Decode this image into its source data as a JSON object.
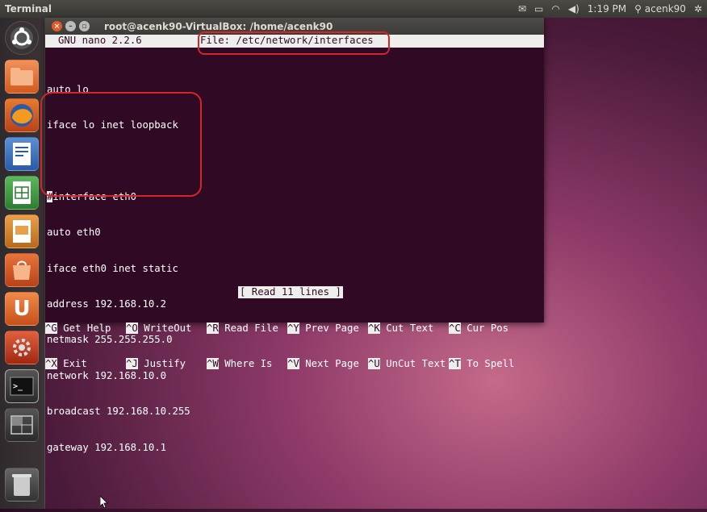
{
  "top_panel": {
    "app_name": "Terminal",
    "time": "1:19 PM",
    "user": "acenk90"
  },
  "window": {
    "title": "root@acenk90-VirtualBox: /home/acenk90"
  },
  "nano": {
    "version": "GNU nano 2.2.6",
    "file": "File: /etc/network/interfaces",
    "lines": [
      "",
      "auto lo",
      "iface lo inet loopback",
      "",
      "interface eth0",
      "auto eth0",
      "iface eth0 inet static",
      "address 192.168.10.2",
      "netmask 255.255.255.0",
      "network 192.168.10.0",
      "broadcast 192.168.10.255",
      "gateway 192.168.10.1"
    ],
    "cursor_char": "#",
    "status": "[ Read 11 lines ]",
    "shortcuts_row1": [
      {
        "key": "^G",
        "label": "Get Help"
      },
      {
        "key": "^O",
        "label": "WriteOut"
      },
      {
        "key": "^R",
        "label": "Read File"
      },
      {
        "key": "^Y",
        "label": "Prev Page"
      },
      {
        "key": "^K",
        "label": "Cut Text"
      },
      {
        "key": "^C",
        "label": "Cur Pos"
      }
    ],
    "shortcuts_row2": [
      {
        "key": "^X",
        "label": "Exit"
      },
      {
        "key": "^J",
        "label": "Justify"
      },
      {
        "key": "^W",
        "label": "Where Is"
      },
      {
        "key": "^V",
        "label": "Next Page"
      },
      {
        "key": "^U",
        "label": "UnCut Text"
      },
      {
        "key": "^T",
        "label": "To Spell"
      }
    ]
  },
  "launcher": [
    {
      "name": "dash-home-icon"
    },
    {
      "name": "files-icon"
    },
    {
      "name": "firefox-icon"
    },
    {
      "name": "writer-icon"
    },
    {
      "name": "calc-icon"
    },
    {
      "name": "impress-icon"
    },
    {
      "name": "software-center-icon"
    },
    {
      "name": "ubuntu-one-icon"
    },
    {
      "name": "system-settings-icon"
    },
    {
      "name": "terminal-icon"
    },
    {
      "name": "workspace-switcher-icon"
    },
    {
      "name": "trash-icon"
    }
  ],
  "colors": {
    "terminal_bg": "#300a24",
    "annotation": "#d32626",
    "ubuntu_orange": "#dd4814"
  }
}
